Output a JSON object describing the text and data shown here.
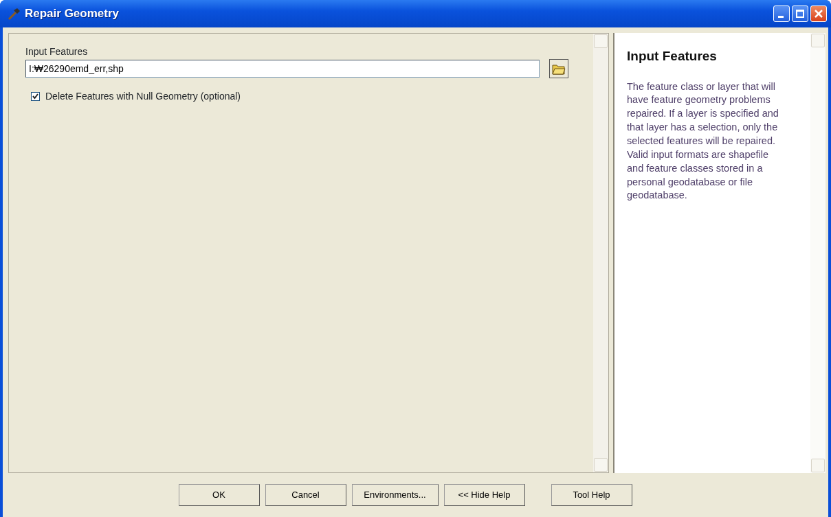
{
  "window": {
    "title": "Repair Geometry"
  },
  "parameters": [
    {
      "kind": "field",
      "label": "Input Features",
      "value": "I:₩26290emd_err,shp"
    },
    {
      "kind": "checkbox",
      "label": "Delete Features with Null Geometry (optional)",
      "checked": true
    }
  ],
  "help": {
    "title": "Input Features",
    "text": "The feature class or layer that will have feature geometry problems repaired. If a layer is specified and that layer has a selection, only the selected features will be repaired. Valid input formats are shapefile and feature classes stored in a personal geodatabase or file geodatabase."
  },
  "buttons": [
    "OK",
    "Cancel",
    "Environments...",
    "<< Hide Help",
    "Tool Help"
  ]
}
